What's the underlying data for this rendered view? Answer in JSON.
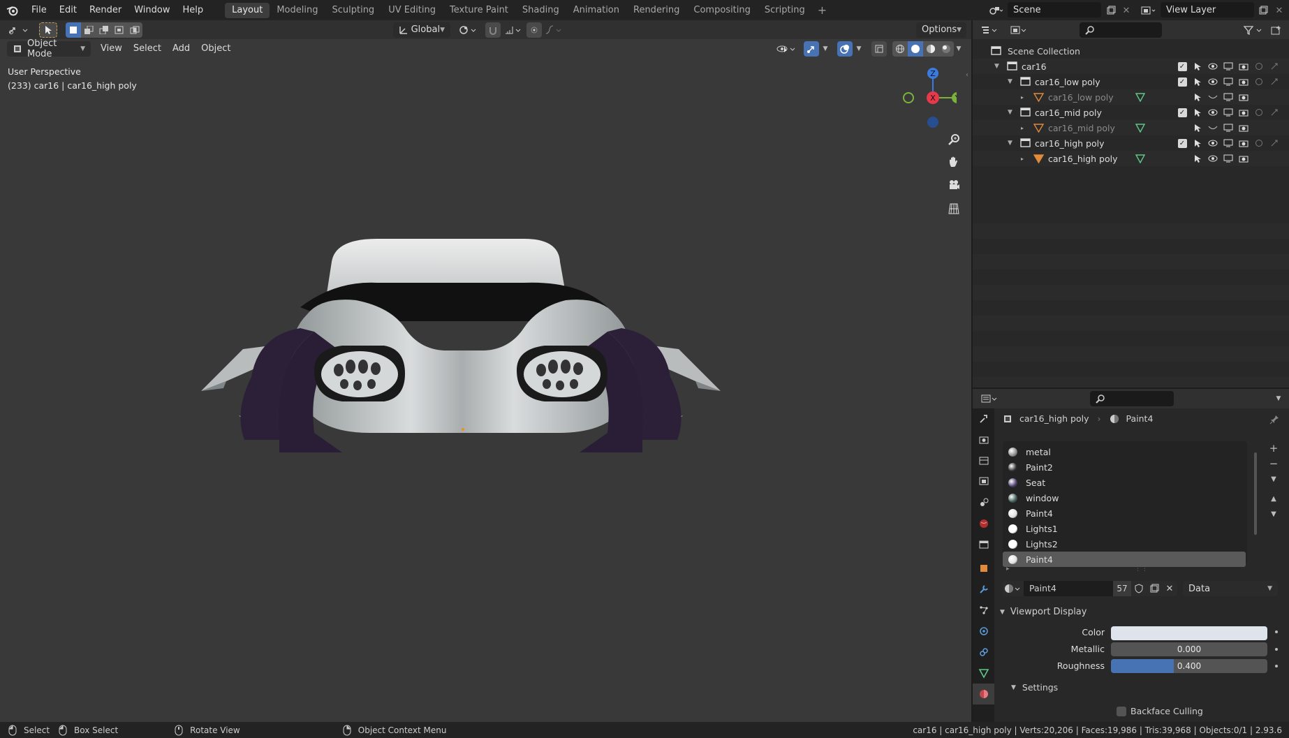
{
  "topbar": {
    "menus": [
      "File",
      "Edit",
      "Render",
      "Window",
      "Help"
    ],
    "workspaces": [
      "Layout",
      "Modeling",
      "Sculpting",
      "UV Editing",
      "Texture Paint",
      "Shading",
      "Animation",
      "Rendering",
      "Compositing",
      "Scripting"
    ],
    "active_workspace": "Layout",
    "plus": "+",
    "scene": "Scene",
    "view_layer": "View Layer"
  },
  "viewport": {
    "transform_orientation": "Global",
    "options_label": "Options",
    "mode": "Object Mode",
    "menus": [
      "View",
      "Select",
      "Add",
      "Object"
    ],
    "perspective": "User Perspective",
    "object_info": "(233) car16 | car16_high poly",
    "gizmo": {
      "z": "Z",
      "x": "X",
      "y": "Y"
    }
  },
  "outliner": {
    "root": "Scene Collection",
    "rows": [
      {
        "label": "car16",
        "type": "collection",
        "indent": 1,
        "checkbox": true,
        "dim": false
      },
      {
        "label": "car16_low poly",
        "type": "collection",
        "indent": 2,
        "checkbox": true,
        "dim": false
      },
      {
        "label": "car16_low poly",
        "type": "mesh",
        "indent": 3,
        "checkbox": false,
        "dim": true
      },
      {
        "label": "car16_mid poly",
        "type": "collection",
        "indent": 2,
        "checkbox": true,
        "dim": false
      },
      {
        "label": "car16_mid poly",
        "type": "mesh",
        "indent": 3,
        "checkbox": false,
        "dim": true
      },
      {
        "label": "car16_high poly",
        "type": "collection",
        "indent": 2,
        "checkbox": true,
        "dim": false
      },
      {
        "label": "car16_high poly",
        "type": "mesh",
        "indent": 3,
        "checkbox": false,
        "dim": false
      }
    ]
  },
  "properties": {
    "breadcrumb_object": "car16_high poly",
    "breadcrumb_material": "Paint4",
    "materials": [
      {
        "name": "metal",
        "color": "#8a8a8a"
      },
      {
        "name": "Paint2",
        "color": "#2a2a2a"
      },
      {
        "name": "Seat",
        "color": "#4a3a6a"
      },
      {
        "name": "window",
        "color": "#3c5a55"
      },
      {
        "name": "Paint4",
        "color": "#e0e0e0"
      },
      {
        "name": "Lights1",
        "color": "#ffffff"
      },
      {
        "name": "Lights2",
        "color": "#ffffff"
      },
      {
        "name": "Paint4",
        "color": "#e0e0e0"
      }
    ],
    "selected_index": 7,
    "material_name": "Paint4",
    "user_count": "57",
    "link": "Data",
    "panel_viewport_display": "Viewport Display",
    "color_label": "Color",
    "color_value": "#dfe3ec",
    "metallic_label": "Metallic",
    "metallic_value": "0.000",
    "metallic_fraction": 0.0,
    "roughness_label": "Roughness",
    "roughness_value": "0.400",
    "roughness_fraction": 0.4,
    "subpanel_settings": "Settings",
    "backface_label": "Backface Culling"
  },
  "statusbar": {
    "select": "Select",
    "box_select": "Box Select",
    "rotate_view": "Rotate View",
    "context_menu": "Object Context Menu",
    "stats": "car16 | car16_high poly | Verts:20,206 | Faces:19,986 | Tris:39,968 | Objects:0/1 | 2.93.6"
  }
}
